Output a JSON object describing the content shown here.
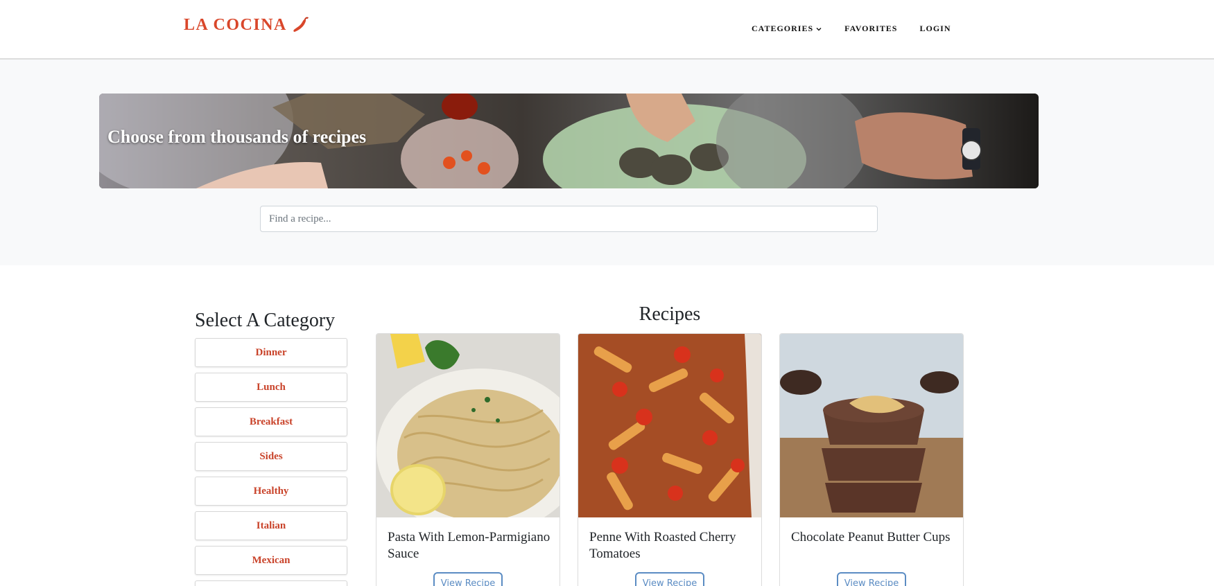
{
  "brand": {
    "name": "LA COCINA",
    "color": "#d9472b",
    "icon": "chili-pepper-icon"
  },
  "nav": {
    "items": [
      {
        "label": "CATEGORIES",
        "icon": "chevron-down-icon"
      },
      {
        "label": "FAVORITES"
      },
      {
        "label": "LOGIN"
      }
    ]
  },
  "hero": {
    "title": "Choose from thousands of recipes",
    "search_placeholder": "Find a recipe..."
  },
  "sidebar": {
    "title": "Select A Category",
    "categories": [
      "Dinner",
      "Lunch",
      "Breakfast",
      "Sides",
      "Healthy",
      "Italian",
      "Mexican"
    ]
  },
  "recipes": {
    "title": "Recipes",
    "items": [
      {
        "name": "Pasta With Lemon-Parmigiano Sauce",
        "button": "View Recipe"
      },
      {
        "name": "Penne With Roasted Cherry Tomatoes",
        "button": "View Recipe"
      },
      {
        "name": "Chocolate Peanut Butter Cups",
        "button": "View Recipe"
      }
    ]
  },
  "colors": {
    "accent": "#d9472b",
    "link_blue": "#5b8cc3",
    "hero_bg": "#f8f9fa"
  }
}
